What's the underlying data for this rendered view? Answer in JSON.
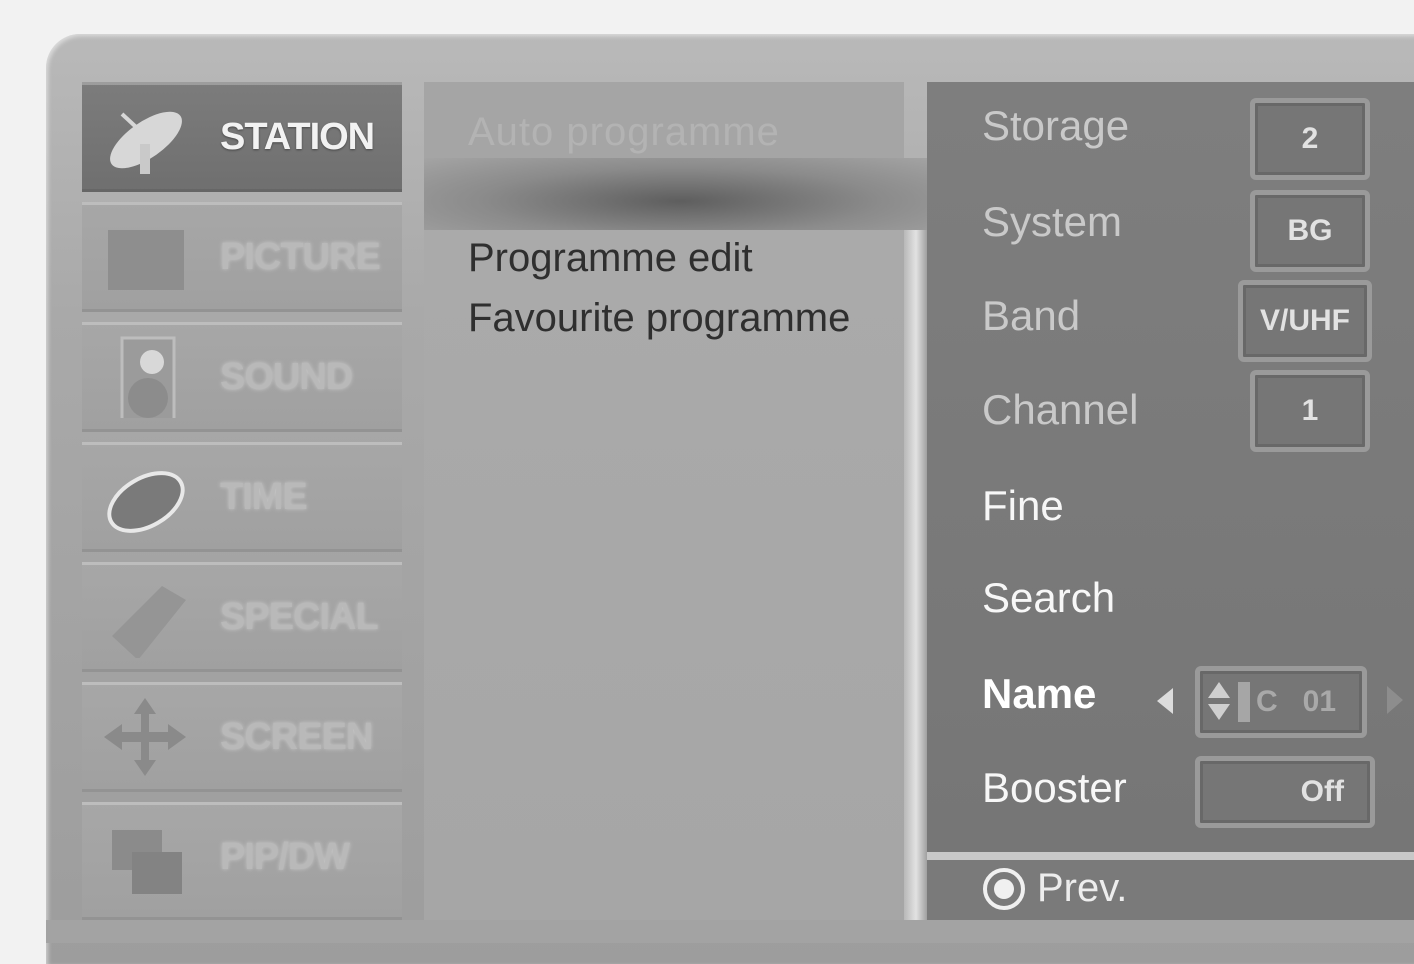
{
  "left_menu": [
    {
      "label": "STATION",
      "icon": "satellite-dish-icon",
      "active": true
    },
    {
      "label": "PICTURE",
      "icon": "picture-icon",
      "active": false
    },
    {
      "label": "SOUND",
      "icon": "speaker-icon",
      "active": false
    },
    {
      "label": "TIME",
      "icon": "clock-icon",
      "active": false
    },
    {
      "label": "SPECIAL",
      "icon": "tag-icon",
      "active": false
    },
    {
      "label": "SCREEN",
      "icon": "arrows-icon",
      "active": false
    },
    {
      "label": "PIP/DW",
      "icon": "pip-icon",
      "active": false
    }
  ],
  "submenu": {
    "items": [
      "Auto programme",
      "Programme edit",
      "Favourite programme"
    ]
  },
  "settings": {
    "storage": {
      "label": "Storage",
      "value": "2"
    },
    "system": {
      "label": "System",
      "value": "BG"
    },
    "band": {
      "label": "Band",
      "value": "V/UHF"
    },
    "channel": {
      "label": "Channel",
      "value": "1"
    },
    "fine": {
      "label": "Fine"
    },
    "search": {
      "label": "Search"
    },
    "name": {
      "label": "Name",
      "value": "C   01"
    },
    "booster": {
      "label": "Booster",
      "value": "Off"
    }
  },
  "footer": {
    "prev_label": "Prev."
  }
}
